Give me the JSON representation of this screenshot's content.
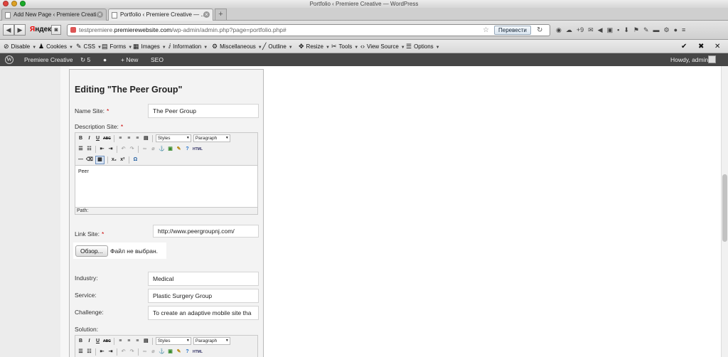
{
  "window": {
    "title": "Portfolio ‹ Premiere Creative — WordPress"
  },
  "tabs": [
    {
      "label": "Add New Page ‹ Premiere Creati..."
    },
    {
      "label": "Portfolio ‹ Premiere Creative — ..."
    }
  ],
  "navbar": {
    "yandex_label_y": "Я",
    "yandex_label_rest": "ндекс",
    "url_prefix": "testpremiere.",
    "url_domain": "premierewebsite.com",
    "url_path": "/wp-admin/admin.php?page=portfolio.php#",
    "translate_button": "Перевести",
    "badge_count": "+9"
  },
  "devbar": {
    "items": [
      "Disable",
      "Cookies",
      "CSS",
      "Forms",
      "Images",
      "Information",
      "Miscellaneous",
      "Outline",
      "Resize",
      "Tools",
      "View Source",
      "Options"
    ]
  },
  "wpbar": {
    "site_name": "Premiere Creative",
    "updates_count": "5",
    "comments_icon": "comment-icon",
    "new_label": "New",
    "seo_label": "SEO",
    "howdy": "Howdy, admin"
  },
  "form": {
    "heading": "Editing \"The Peer Group\"",
    "name_label": "Name Site:",
    "name_value": "The Peer Group",
    "description_label": "Description Site:",
    "editor1_content": "Peer",
    "path_label": "Path:",
    "link_label": "Link Site:",
    "link_value": "http://www.peergroupnj.com/",
    "file_button": "Обзор...",
    "file_status": "Файл не выбран.",
    "industry_label": "Industry:",
    "industry_value": "Medical",
    "service_label": "Service:",
    "service_value": "Plastic Surgery Group",
    "challenge_label": "Challenge:",
    "challenge_value": "To create an adaptive mobile site tha",
    "solution_label": "Solution:",
    "styles_select": "Styles",
    "paragraph_select": "Paragraph",
    "html_button": "HTML"
  }
}
